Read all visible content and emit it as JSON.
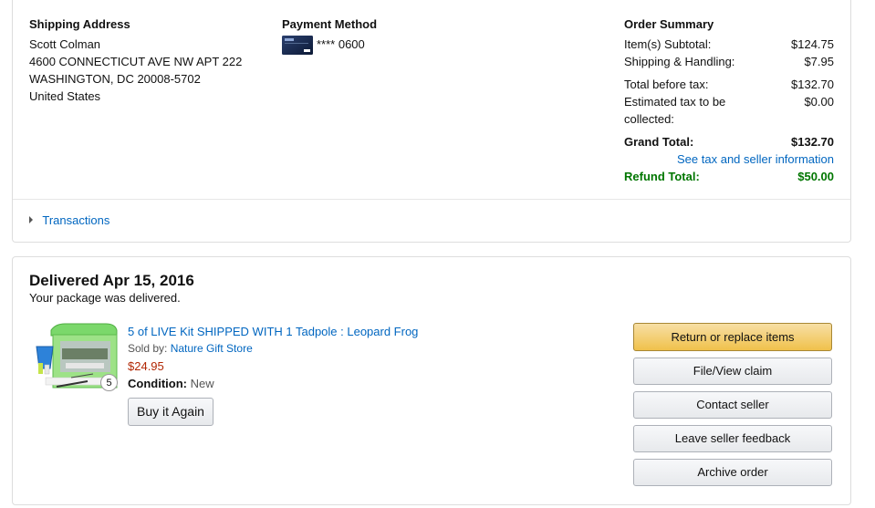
{
  "shipping": {
    "heading": "Shipping Address",
    "name": "Scott Colman",
    "street": "4600 CONNECTICUT AVE NW APT 222",
    "city": "WASHINGTON, DC 20008-5702",
    "country": "United States"
  },
  "payment": {
    "heading": "Payment Method",
    "card_masked": "**** 0600",
    "card_icon": "visa-card-icon"
  },
  "summary": {
    "heading": "Order Summary",
    "subtotal_label": "Item(s) Subtotal:",
    "subtotal_value": "$124.75",
    "shipping_label": "Shipping & Handling:",
    "shipping_value": "$7.95",
    "before_tax_label": "Total before tax:",
    "before_tax_value": "$132.70",
    "tax_label_1": "Estimated tax to be",
    "tax_label_2": "collected:",
    "tax_value": "$0.00",
    "grand_label": "Grand Total:",
    "grand_value": "$132.70",
    "tax_seller_link": "See tax and seller information",
    "refund_label": "Refund Total:",
    "refund_value": "$50.00"
  },
  "transactions": {
    "label": "Transactions"
  },
  "shipment": {
    "status": "Delivered Apr 15, 2016",
    "substatus": "Your package was delivered.",
    "item": {
      "title": "5 of LIVE Kit SHIPPED WITH 1 Tadpole : Leopard Frog",
      "sold_by_label": "Sold by:",
      "seller": "Nature Gift Store",
      "price": "$24.95",
      "condition_label": "Condition:",
      "condition_value": "New",
      "quantity": "5",
      "buy_again": "Buy it Again"
    },
    "actions": {
      "return": "Return or replace items",
      "claim": "File/View claim",
      "contact": "Contact seller",
      "feedback": "Leave seller feedback",
      "archive": "Archive order"
    }
  },
  "colors": {
    "link": "#0066c0",
    "refund": "#007600",
    "price": "#b12704",
    "primary_button": "#f0c14b"
  }
}
